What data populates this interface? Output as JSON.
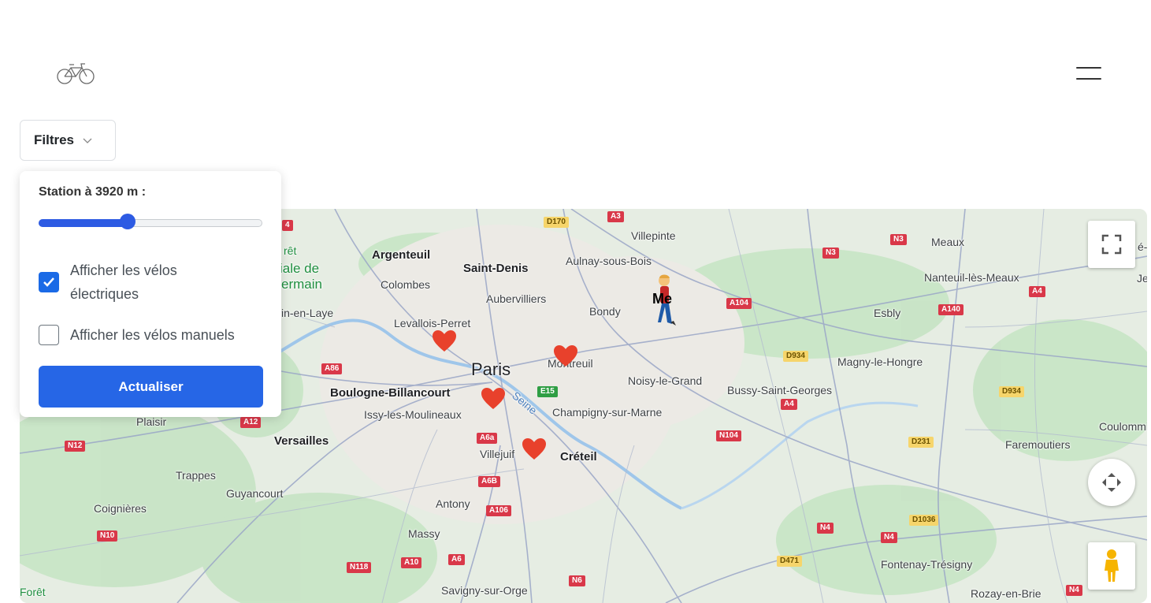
{
  "header": {
    "logo_icon": "bicycle-icon",
    "menu_icon": "hamburger-menu-icon"
  },
  "filters": {
    "button_label": "Filtres",
    "station_label": "Station à 3920 m :",
    "slider_value_fraction": 0.4,
    "checkboxes": [
      {
        "label": "Afficher les vélos électriques",
        "checked": true
      },
      {
        "label": "Afficher les vélos manuels",
        "checked": false
      }
    ],
    "update_label": "Actualiser"
  },
  "map": {
    "places": {
      "villepinte": "Villepinte",
      "argenteuil": "Argenteuil",
      "saint_denis": "Saint-Denis",
      "aulnay": "Aulnay-sous-Bois",
      "colombes": "Colombes",
      "aubervilliers": "Aubervilliers",
      "bondy": "Bondy",
      "levallois": "Levallois-Perret",
      "paris": "Paris",
      "montreuil": "Montreuil",
      "noisy": "Noisy-le-Grand",
      "boulogne": "Boulogne-Billancourt",
      "issy": "Issy-les-Moulineaux",
      "champigny": "Champigny-sur-Marne",
      "versailles": "Versailles",
      "villejuif": "Villejuif",
      "creteil": "Créteil",
      "plaisir": "Plaisir",
      "trappes": "Trappes",
      "guyancourt": "Guyancourt",
      "coignieres": "Coignières",
      "antony": "Antony",
      "massy": "Massy",
      "savigny": "Savigny-sur-Orge",
      "meaux": "Meaux",
      "nanteuil": "Nanteuil-lès-Meaux",
      "esbly": "Esbly",
      "magny": "Magny-le-Hongre",
      "bussy": "Bussy-Saint-Georges",
      "coulommiers": "Coulommie",
      "faremoutiers": "Faremoutiers",
      "fontenay": "Fontenay-Trésigny",
      "rozay": "Rozay-en-Brie",
      "laye": "in-en-Laye",
      "foret_1": "rêt",
      "foret_2": "iale de",
      "foret_3": "ermain",
      "seine": "Seine",
      "foret_bottom": "Forêt",
      "right_edge_1": "é-",
      "right_edge_2": "Je"
    },
    "roads": {
      "d170": "D170",
      "a3": "A3",
      "n3a": "N3",
      "n3b": "N3",
      "a4": "A4",
      "a104": "A104",
      "a140": "A140",
      "d934a": "D934",
      "d934b": "D934",
      "a4b": "A4",
      "a86": "A86",
      "e15": "E15",
      "n104": "N104",
      "d231": "D231",
      "a12": "A12",
      "n12": "N12",
      "a6a": "A6a",
      "a6b": "A6B",
      "a106": "A106",
      "n10": "N10",
      "n118": "N118",
      "a10": "A10",
      "a6": "A6",
      "n6": "N6",
      "n4a": "N4",
      "n4b": "N4",
      "d1036": "D1036",
      "d471": "D471",
      "n4c": "N4",
      "a4left": "4"
    },
    "me_label": "Me",
    "marker_icon": "heart-icon",
    "controls": {
      "fullscreen": "fullscreen-icon",
      "camera": "camera-control-icon",
      "pegman": "pegman-icon"
    }
  }
}
